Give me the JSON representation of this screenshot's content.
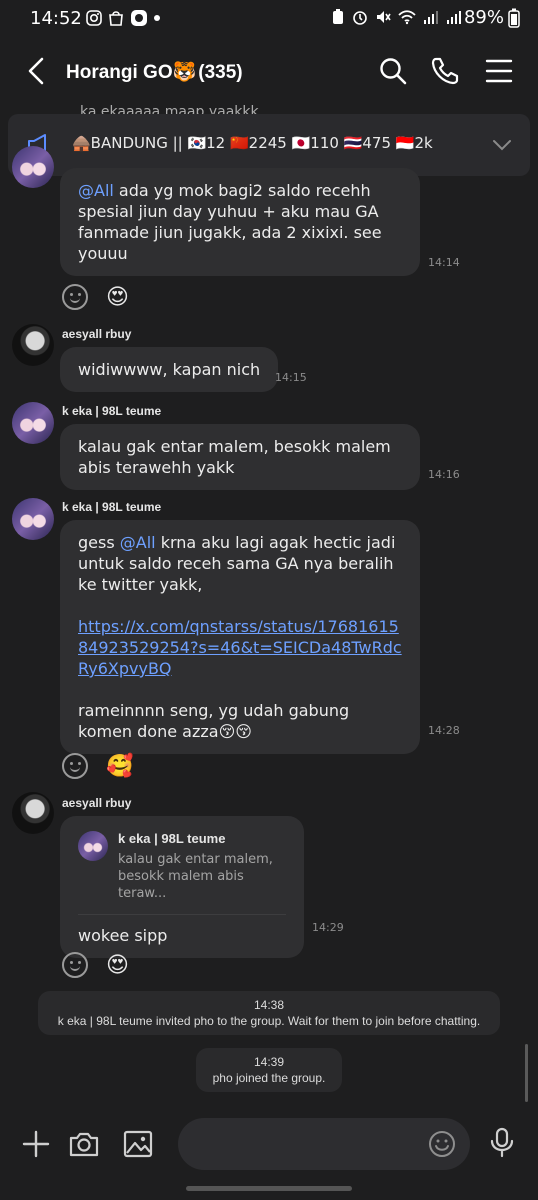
{
  "status_bar": {
    "time": "14:52",
    "battery": "89%"
  },
  "header": {
    "title": "Horangi GO🐯",
    "member_count": "(335)"
  },
  "pinned_peek": "ka ekaaaaa maap yaakkk",
  "announcement": {
    "text": "🛖BANDUNG || 🇰🇷12 🇨🇳2245 🇯🇵110 🇹🇭475 🇮🇩2k"
  },
  "messages": [
    {
      "mention": "@All",
      "text": " ada yg mok bagi2 saldo recehh spesial jiun day yuhuu + aku mau GA fanmade jiun jugakk, ada 2 xixixi. see youuu",
      "time": "14:14",
      "reaction": "😍"
    },
    {
      "sender": "aesyall rbuy",
      "text": "widiwwww, kapan nich",
      "time": "14:15"
    },
    {
      "sender": "k eka | 98L teume",
      "text": "kalau gak entar malem, besokk malem abis terawehh yakk",
      "time": "14:16"
    },
    {
      "sender": "k eka | 98L teume",
      "text_before": "gess ",
      "mention": "@All",
      "text_after": " krna aku lagi agak hectic jadi untuk saldo receh sama GA nya beralih ke twitter yakk,",
      "link": "https://x.com/qnstarss/status/1768161584923529254?s=46&t=SEICDa48TwRdcRy6XpvyBQ",
      "text_end": "rameinnnn seng, yg udah gabung komen done azza😚😚",
      "time": "14:28",
      "reaction": "🥰"
    },
    {
      "sender": "aesyall rbuy",
      "reply_to_name": "k eka | 98L teume",
      "reply_to_text": "kalau gak entar malem, besokk malem abis teraw...",
      "text": "wokee sipp",
      "time": "14:29",
      "reaction": "😍"
    }
  ],
  "system_messages": [
    {
      "time": "14:38",
      "text": "k eka | 98L teume invited pho to the group. Wait for them to join before chatting."
    },
    {
      "time": "14:39",
      "text": "pho joined the group."
    }
  ],
  "input": {
    "placeholder": ""
  },
  "icons": {
    "back": "chevron-left-icon",
    "search": "search-icon",
    "call": "phone-icon",
    "menu": "hamburger-menu-icon",
    "announce": "megaphone-icon",
    "expand": "chevron-down-icon",
    "add": "plus-icon",
    "camera": "camera-icon",
    "gallery": "image-icon",
    "emoji": "smiley-icon",
    "mic": "microphone-icon"
  },
  "colors": {
    "background": "#1e1e1f",
    "bubble": "#2f2f31",
    "mention": "#6ea0ff",
    "timestamp": "#8c8c8c"
  }
}
